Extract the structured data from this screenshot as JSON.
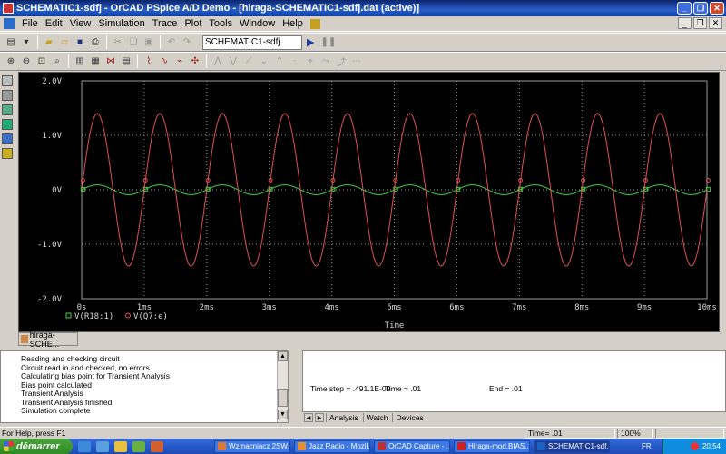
{
  "window": {
    "title": "SCHEMATIC1-sdfj - OrCAD PSpice A/D Demo  - [hiraga-SCHEMATIC1-sdfj.dat (active)]"
  },
  "menu": {
    "items": [
      "File",
      "Edit",
      "View",
      "Simulation",
      "Trace",
      "Plot",
      "Tools",
      "Window",
      "Help"
    ]
  },
  "toolbar": {
    "profile_value": "SCHEMATIC1-sdfj"
  },
  "plot": {
    "doc_tab_label": "hiraga-SCHE...",
    "x_axis_label": "Time",
    "colors": {
      "bg": "#000000",
      "grid": "#9a9a9a",
      "trace1": "#3fd23f",
      "trace2": "#e05050",
      "axis_text": "#d8d8d8"
    }
  },
  "chart_data": {
    "type": "line",
    "title": "",
    "xlabel": "Time",
    "ylabel": "",
    "x_ticks": [
      "0s",
      "1ms",
      "2ms",
      "3ms",
      "4ms",
      "5ms",
      "6ms",
      "7ms",
      "8ms",
      "9ms",
      "10ms"
    ],
    "y_ticks": [
      "2.0V",
      "1.0V",
      "0V",
      "-1.0V",
      "-2.0V"
    ],
    "xlim": [
      0,
      10
    ],
    "ylim": [
      -2.0,
      2.0
    ],
    "grid": true,
    "legend_position": "bottom-left",
    "series": [
      {
        "name": "V(R18:1)",
        "color": "#3fd23f",
        "marker": "square",
        "waveform": "sine",
        "frequency_khz": 1,
        "amplitude_v": 0.09,
        "offset_v": 0.0,
        "phase_deg": 0
      },
      {
        "name": "V(Q7:e)",
        "color": "#e05050",
        "marker": "circle",
        "waveform": "sine",
        "frequency_khz": 1,
        "amplitude_v": 1.4,
        "offset_v": 0.0,
        "phase_deg": 0
      }
    ]
  },
  "output_log": {
    "lines": [
      "Reading and checking circuit",
      "Circuit read in and checked, no errors",
      "Calculating bias point for Transient Analysis",
      "Bias point calculated",
      "Transient Analysis",
      "Transient Analysis finished",
      "Simulation complete"
    ]
  },
  "watch": {
    "time_step": "Time step = .491.1E-09",
    "time": "Time = .01",
    "end": "End = .01",
    "tabs": [
      "Analysis",
      "Watch",
      "Devices"
    ]
  },
  "status": {
    "help": "For Help, press F1",
    "time": "Time= .01",
    "zoom": "100%"
  },
  "taskbar": {
    "start_label": "démarrer",
    "tasks": [
      {
        "label": "Wzmacniacz 2SW...",
        "color": "#e07830"
      },
      {
        "label": "Jazz Radio - Mozil...",
        "color": "#e89030"
      },
      {
        "label": "OrCAD Capture - ...",
        "color": "#c03030"
      },
      {
        "label": "Hiraga-mod.BIAS...",
        "color": "#d02020"
      },
      {
        "label": "SCHEMATIC1-sdf...",
        "color": "#2060c0"
      }
    ],
    "lang": "FR",
    "clock": "20:54"
  }
}
